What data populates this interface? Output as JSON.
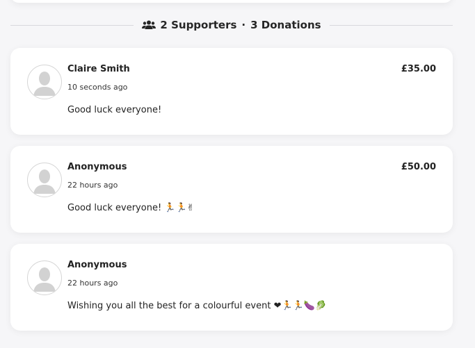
{
  "header": {
    "supporters": "2 Supporters",
    "separator": "·",
    "donations": "3 Donations",
    "icon": "users-icon"
  },
  "donations": [
    {
      "name": "Claire Smith",
      "time": "10 seconds ago",
      "amount": "£35.00",
      "message": "Good luck everyone!"
    },
    {
      "name": "Anonymous",
      "time": "22 hours ago",
      "amount": "£50.00",
      "message": "Good luck everyone! 🏃🏃✌"
    },
    {
      "name": "Anonymous",
      "time": "22 hours ago",
      "amount": "",
      "message": "Wishing you all the best for a colourful event ❤🏃🏃🍆🥬"
    }
  ],
  "colors": {
    "background": "#f6f6f8",
    "card": "#ffffff",
    "text": "#222222",
    "avatar_fill": "#d2d2d2"
  }
}
